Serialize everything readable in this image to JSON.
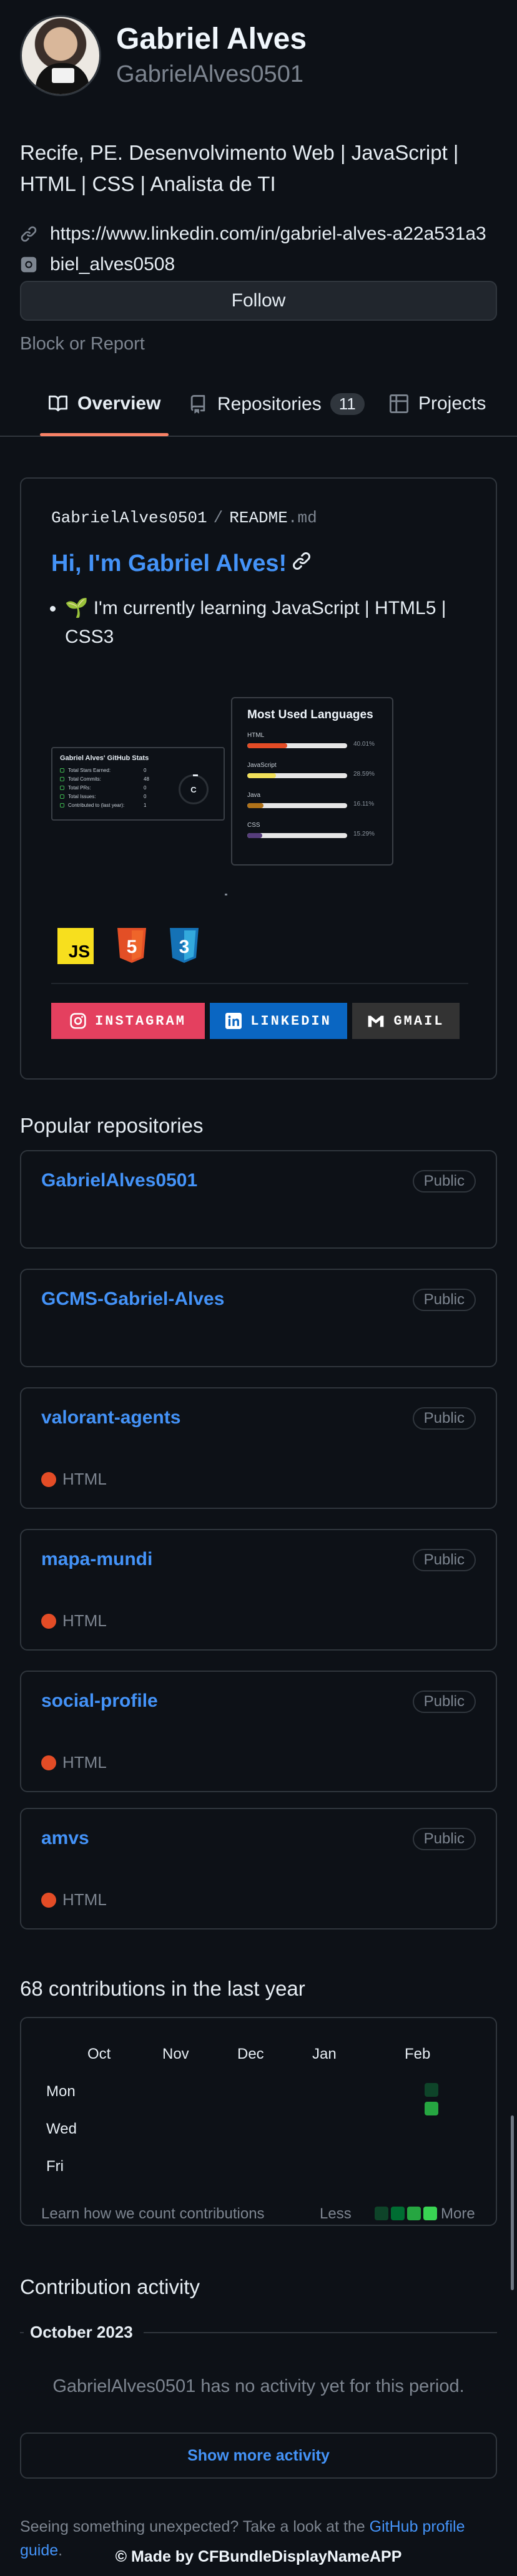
{
  "profile": {
    "display_name": "Gabriel Alves",
    "login": "GabrielAlves0501",
    "bio": "Recife, PE. Desenvolvimento Web | JavaScript | HTML | CSS | Analista de TI",
    "linkedin": "https://www.linkedin.com/in/gabriel-alves-a22a531a3",
    "instagram": "biel_alves0508",
    "follow_label": "Follow",
    "block_label": "Block or Report"
  },
  "tabs": [
    {
      "label": "Overview",
      "icon": "book-icon",
      "active": true
    },
    {
      "label": "Repositories",
      "icon": "repo-icon",
      "count": "11"
    },
    {
      "label": "Projects",
      "icon": "table-icon"
    }
  ],
  "readme": {
    "owner": "GabrielAlves0501",
    "separator": "/",
    "file": "README",
    "ext": ".md",
    "title": "Hi, I'm Gabriel Alves!",
    "items": [
      "🌱 I'm currently learning JavaScript | HTML5 | CSS3"
    ],
    "stats_card": {
      "title": "Gabriel Alves' GitHub Stats",
      "rows": [
        {
          "label": "Total Stars Earned:",
          "value": "0"
        },
        {
          "label": "Total Commits:",
          "value": "48"
        },
        {
          "label": "Total PRs:",
          "value": "0"
        },
        {
          "label": "Total Issues:",
          "value": "0"
        },
        {
          "label": "Contributed to (last year):",
          "value": "1"
        }
      ],
      "rank": "C"
    },
    "languages_card": {
      "title": "Most Used Languages",
      "langs": [
        {
          "name": "HTML",
          "pct": "40.01%",
          "value": 40.01,
          "color": "#e34c26"
        },
        {
          "name": "JavaScript",
          "pct": "28.59%",
          "value": 28.59,
          "color": "#f1e05a"
        },
        {
          "name": "Java",
          "pct": "16.11%",
          "value": 16.11,
          "color": "#b07219"
        },
        {
          "name": "CSS",
          "pct": "15.29%",
          "value": 15.29,
          "color": "#563d7c"
        }
      ]
    },
    "tech_badges": [
      "JS",
      "5",
      "3"
    ],
    "social": [
      {
        "label": "INSTAGRAM",
        "icon": "instagram-icon",
        "color": "#e4405f"
      },
      {
        "label": "LINKEDIN",
        "icon": "linkedin-icon",
        "color": "#0a66c2"
      },
      {
        "label": "GMAIL",
        "icon": "gmail-icon",
        "color": "#333333"
      }
    ]
  },
  "popular": {
    "title": "Popular repositories",
    "repos": [
      {
        "name": "GabrielAlves0501",
        "visibility": "Public",
        "language": ""
      },
      {
        "name": "GCMS-Gabriel-Alves",
        "visibility": "Public",
        "language": ""
      },
      {
        "name": "valorant-agents",
        "visibility": "Public",
        "language": "HTML"
      },
      {
        "name": "mapa-mundi",
        "visibility": "Public",
        "language": "HTML"
      },
      {
        "name": "social-profile",
        "visibility": "Public",
        "language": "HTML"
      },
      {
        "name": "amvs",
        "visibility": "Public",
        "language": "HTML"
      }
    ]
  },
  "contributions": {
    "title": "68 contributions in the last year",
    "months": [
      "Oct",
      "Nov",
      "Dec",
      "Jan",
      "Feb"
    ],
    "days": [
      "Mon",
      "Wed",
      "Fri"
    ],
    "learn": "Learn how we count contributions",
    "less": "Less",
    "more": "More",
    "colors": [
      "#0e4429",
      "#006d32",
      "#26a641",
      "#39d353"
    ]
  },
  "activity": {
    "title": "Contribution activity",
    "month": "October 2023",
    "empty": "GabrielAlves0501 has no activity yet for this period.",
    "show_more": "Show more activity"
  },
  "footer": {
    "note": "Seeing something unexpected? Take a look at the",
    "guide": "GitHub profile guide",
    "period": ".",
    "made_by": "© Made by CFBundleDisplayNameAPP"
  }
}
